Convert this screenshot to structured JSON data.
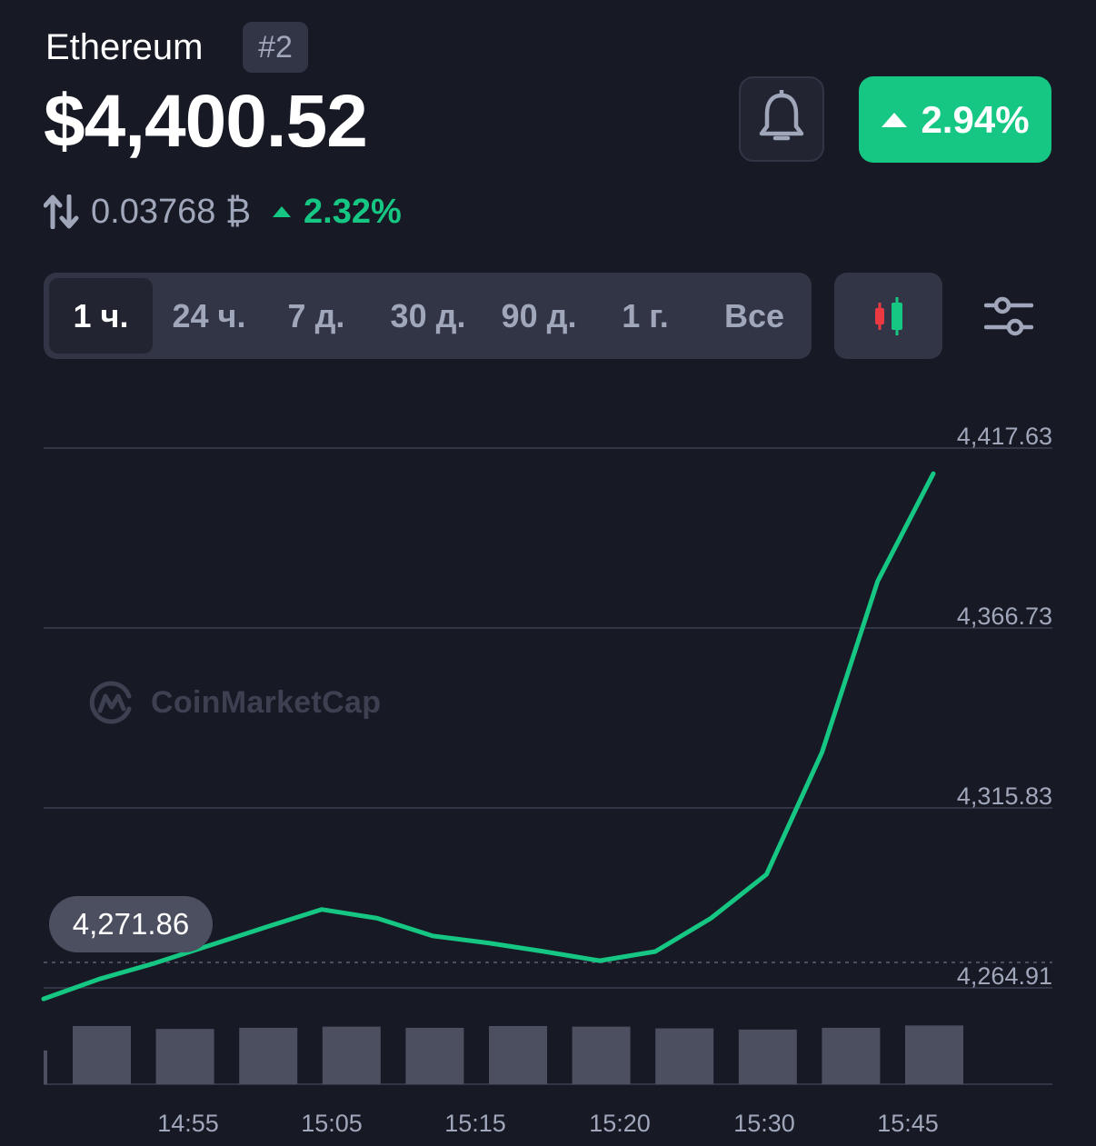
{
  "header": {
    "coin_name": "Ethereum",
    "rank": "#2",
    "price": "$4,400.52",
    "change_24h": "2.94%",
    "btc_price": "0.03768 ₿",
    "btc_change": "2.32%"
  },
  "tabs": [
    {
      "label": "1 ч.",
      "active": true
    },
    {
      "label": "24 ч.",
      "active": false
    },
    {
      "label": "7 д.",
      "active": false
    },
    {
      "label": "30 д.",
      "active": false
    },
    {
      "label": "90 д.",
      "active": false
    },
    {
      "label": "1 г.",
      "active": false
    },
    {
      "label": "Все",
      "active": false
    }
  ],
  "icons": {
    "bell": "bell-icon",
    "change_arrow": "triangle-up-icon",
    "swap": "swap-arrows-icon",
    "candlestick": "candlestick-icon",
    "filter": "sliders-icon",
    "watermark": "coinmarketcap-logo"
  },
  "colors": {
    "background": "#171924",
    "accent_green": "#16c784",
    "candle_red": "#ea3943",
    "muted_text": "#a1a7bb",
    "surface": "#323546",
    "volume_bar": "#4b4f60"
  },
  "watermark_text": "CoinMarketCap",
  "chart_data": {
    "type": "line",
    "y_ticks": [
      "4,417.63",
      "4,366.73",
      "4,315.83",
      "4,264.91"
    ],
    "ylim": [
      4264.91,
      4417.63
    ],
    "x_ticks": [
      "14:55",
      "15:05",
      "15:15",
      "15:20",
      "15:30",
      "15:45"
    ],
    "start_value_label": "4,271.86",
    "reference_line_value": 4271.86,
    "series": [
      {
        "values": [
          4261.8,
          4267.4,
          4271.9,
          4277.0,
          4282.1,
          4287.1,
          4284.6,
          4279.6,
          4277.6,
          4275.2,
          4272.6,
          4275.2,
          4284.6,
          4297.0,
          4331.6,
          4380.0,
          4410.4
        ]
      }
    ],
    "volume": [
      0.58,
      1.0,
      0.95,
      0.97,
      0.99,
      0.97,
      1.0,
      0.99,
      0.96,
      0.94,
      0.97,
      1.01
    ],
    "grid": true,
    "legend": "none"
  }
}
